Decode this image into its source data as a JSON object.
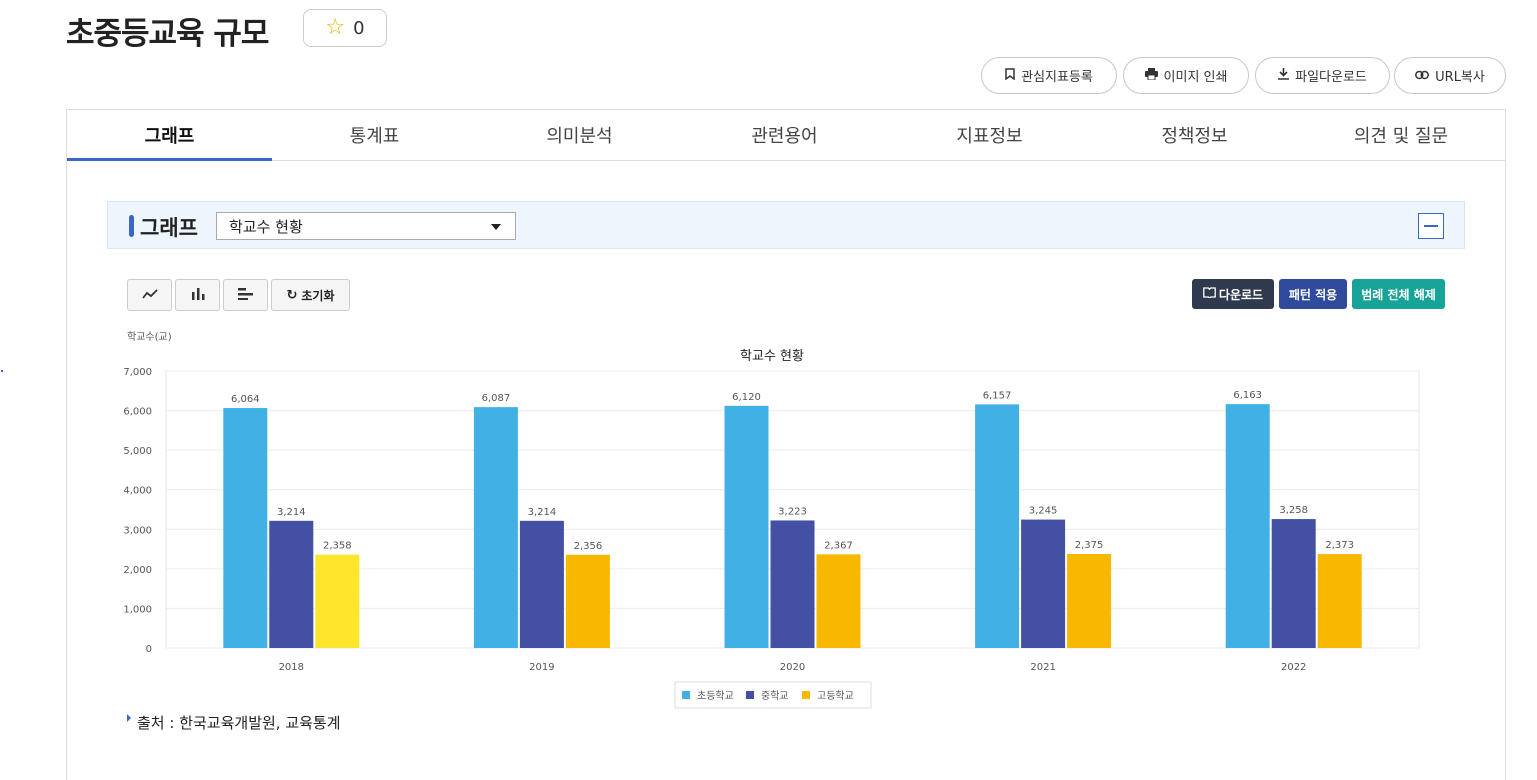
{
  "header": {
    "title": "초중등교육 규모",
    "favorite_count": "0"
  },
  "toolbar": {
    "bookmark": "관심지표등록",
    "print": "이미지 인쇄",
    "download": "파일다운로드",
    "url_copy": "URL복사"
  },
  "tabs": [
    "그래프",
    "통계표",
    "의미분석",
    "관련용어",
    "지표정보",
    "정책정보",
    "의견 및 질문"
  ],
  "graph_section": {
    "label": "그래프",
    "selected": "학교수 현황"
  },
  "chart_controls": {
    "reset": "초기화",
    "download": "다운로드",
    "pattern": "패턴 적용",
    "legend_off": "범례 전체 해제"
  },
  "colors": {
    "accent": "#3a66c9",
    "download_btn": "#2f3a4f",
    "pattern_btn": "#2f4a9c",
    "legend_btn": "#17a398"
  },
  "chart_data": {
    "type": "bar",
    "title": "학교수 현황",
    "ylabel": "학교수(교)",
    "xlabel": "",
    "ylim": [
      0,
      7000
    ],
    "yticks": [
      0,
      1000,
      2000,
      3000,
      4000,
      5000,
      6000,
      7000
    ],
    "ytick_labels": [
      "0",
      "1,000",
      "2,000",
      "3,000",
      "4,000",
      "5,000",
      "6,000",
      "7,000"
    ],
    "grid": true,
    "legend_position": "bottom",
    "categories": [
      "2018",
      "2019",
      "2020",
      "2021",
      "2022"
    ],
    "series": [
      {
        "name": "초등학교",
        "color": "#41b0e5",
        "values": [
          6064,
          6087,
          6120,
          6157,
          6163
        ],
        "labels": [
          "6,064",
          "6,087",
          "6,120",
          "6,157",
          "6,163"
        ]
      },
      {
        "name": "중학교",
        "color": "#4350a4",
        "values": [
          3214,
          3214,
          3223,
          3245,
          3258
        ],
        "labels": [
          "3,214",
          "3,214",
          "3,223",
          "3,245",
          "3,258"
        ]
      },
      {
        "name": "고등학교",
        "color": "#f8b800",
        "values": [
          2358,
          2356,
          2367,
          2375,
          2373
        ],
        "labels": [
          "2,358",
          "2,356",
          "2,367",
          "2,375",
          "2,373"
        ]
      }
    ],
    "highlighted_bar_color": "#fde52a"
  },
  "source": "출처 : 한국교육개발원, 교육통계"
}
